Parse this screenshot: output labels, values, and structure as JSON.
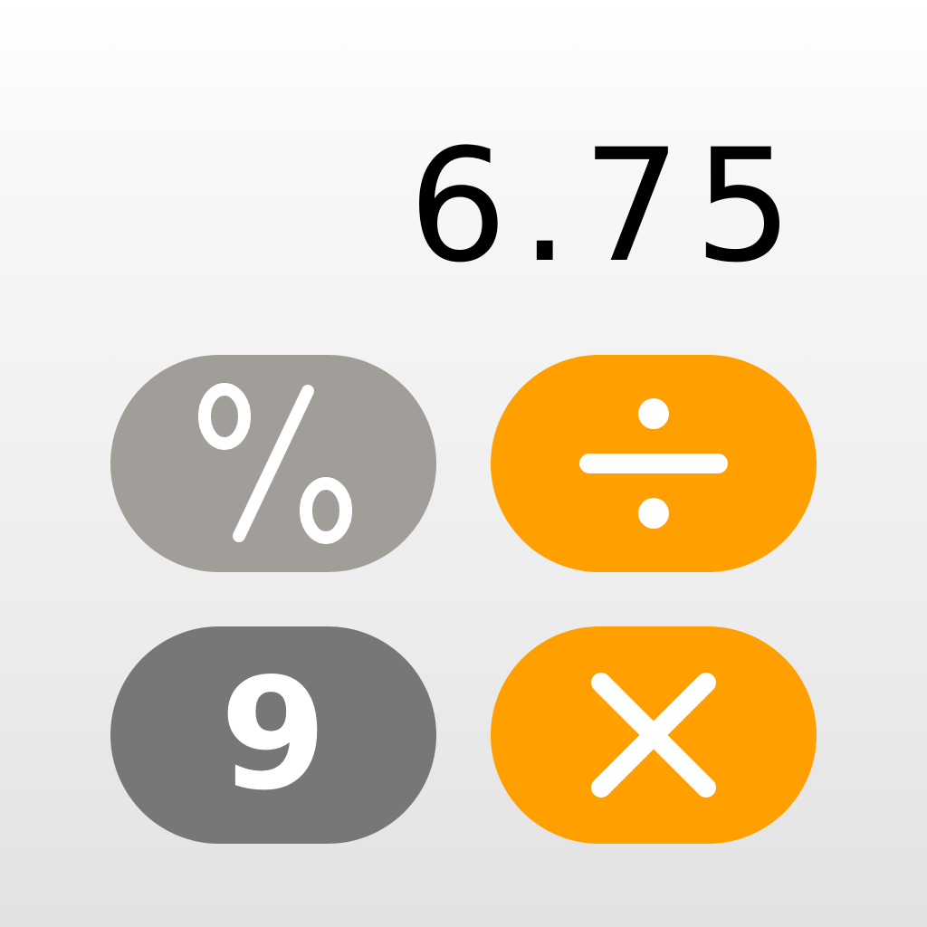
{
  "display": {
    "value": "6.75"
  },
  "keys": {
    "percent": {
      "label": "%",
      "icon": "percent-icon",
      "color": "#a19e99"
    },
    "divide": {
      "label": "÷",
      "icon": "divide-icon",
      "color": "#ff9f00"
    },
    "nine": {
      "label": "9",
      "color": "#787677"
    },
    "multiply": {
      "label": "×",
      "icon": "multiply-icon",
      "color": "#ff9f00"
    }
  },
  "colors": {
    "accent": "#ff9f00",
    "function_key": "#a19e99",
    "digit_key": "#787677",
    "key_text": "#ffffff",
    "display_text": "#000000"
  }
}
